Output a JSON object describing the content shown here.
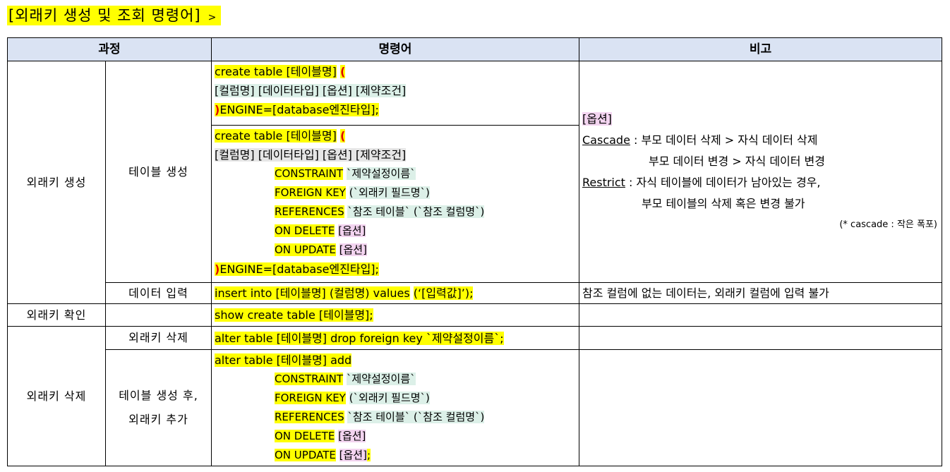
{
  "title": {
    "text": "[외래키 생성 및 조회 명령어]",
    "arrow": ">"
  },
  "headers": {
    "process": "과정",
    "command": "명령어",
    "note": "비고"
  },
  "rows": {
    "create": {
      "group": "외래키 생성",
      "table_create": {
        "label": "테이블 생성",
        "simple": {
          "l1a": "create table [테이블명]",
          "l1b": "(",
          "l2": "[컬럼명] [데이터타입] [옵션] [제약조건]",
          "l3a": ")",
          "l3b": "ENGINE=[database엔진타입];"
        },
        "full": {
          "l1a": "create table [테이블명]",
          "l1b": "(",
          "l2": "[컬럼명] [데이터타입] [옵션] [제약조건]",
          "c1a": "CONSTRAINT",
          "c1b": "`제약설정이름`",
          "c2a": "FOREIGN KEY",
          "c2b": "(`외래키 필드명`)",
          "c3a": "REFERENCES",
          "c3b": "`참조 테이블` (`참조 컬럼명`)",
          "c4a": "ON DELETE",
          "c4b": "[옵션]",
          "c5a": "ON UPDATE",
          "c5b": "[옵션]",
          "l3a": ")",
          "l3b": "ENGINE=[database엔진타입];"
        },
        "note": {
          "option": "[옵션]",
          "cascade_kw": "Cascade",
          "cascade_1": ": 부모 데이터 삭제 > 자식 데이터 삭제",
          "cascade_2": "부모 데이터 변경 > 자식 데이터 변경",
          "restrict_kw": "Restrict",
          "restrict_1": ": 자식 테이블에 데이터가 남아있는 경우,",
          "restrict_2": "부모 테이블의 삭제 혹은 변경 불가",
          "small": "(* cascade : 작은 폭포)"
        }
      },
      "data_input": {
        "label": "데이터 입력",
        "cmd_a": "insert into [테이블명] (컬럼명) values",
        "cmd_b": "(‘[입력값]’);",
        "note": "참조 컬럼에 없는 데이터는, 외래키 컬럼에 입력 불가"
      }
    },
    "check": {
      "group": "외래키 확인",
      "cmd_a": "show create table [테이블명]",
      "cmd_b": ";"
    },
    "delete": {
      "group": "외래키 삭제",
      "drop": {
        "label": "외래키 삭제",
        "cmd": "alter table [테이블명] drop foreign key `제약설정이름`;"
      },
      "add": {
        "label_1": "테이블 생성 후,",
        "label_2": "외래키 추가",
        "l1": "alter table [테이블명] add",
        "c1a": "CONSTRAINT",
        "c1b": "`제약설정이름`",
        "c2a": "FOREIGN KEY",
        "c2b": "(`외래키 필드명`)",
        "c3a": "REFERENCES",
        "c3b": "`참조 테이블` (`참조 컬럼명`)",
        "c4a": "ON DELETE",
        "c4b": "[옵션]",
        "c5a": "ON UPDATE",
        "c5b": "[옵션]",
        "c5c": ";"
      }
    }
  },
  "colors": {
    "highlight_yellow": "#ffff00",
    "highlight_green": "#dcf0e8",
    "highlight_pink": "#f3d4f0",
    "header_bg": "#dae3f3",
    "paren_red": "#e00000"
  }
}
